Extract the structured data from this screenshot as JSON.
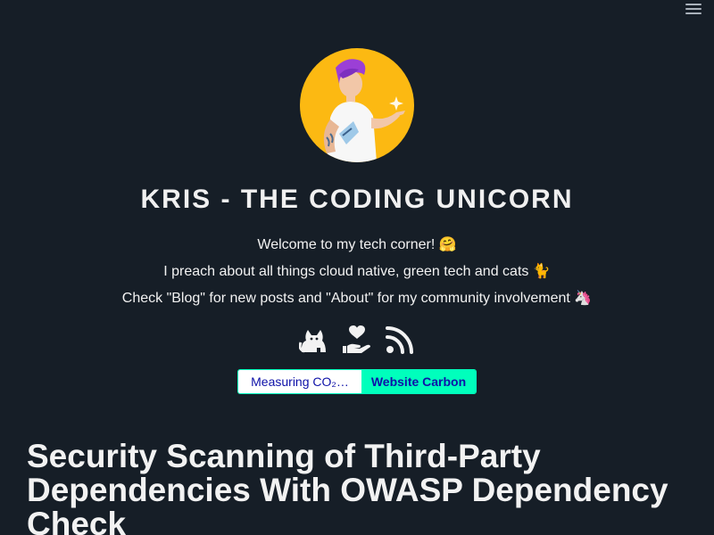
{
  "nav": {
    "menu_icon": "hamburger-menu-icon"
  },
  "header": {
    "avatar_icon": "profile-avatar",
    "title": "KRIS - THE CODING UNICORN",
    "intro_lines": [
      "Welcome to my tech corner! 🤗",
      "I preach about all things cloud native, green tech and cats 🐈",
      "Check \"Blog\" for new posts and \"About\" for my community involvement 🦄"
    ],
    "social_icons": [
      "cat-icon",
      "hand-heart-icon",
      "rss-icon"
    ]
  },
  "carbon_badge": {
    "measuring": "Measuring CO₂…",
    "link": "Website Carbon"
  },
  "post": {
    "title": "Security Scanning of Third-Party Dependencies With OWASP Dependency Check"
  },
  "colors": {
    "background": "#161e27",
    "text": "#f2f2f2",
    "avatar_bg": "#fcb912",
    "carbon_green": "#00ffbc",
    "carbon_text": "#0e11a8"
  }
}
